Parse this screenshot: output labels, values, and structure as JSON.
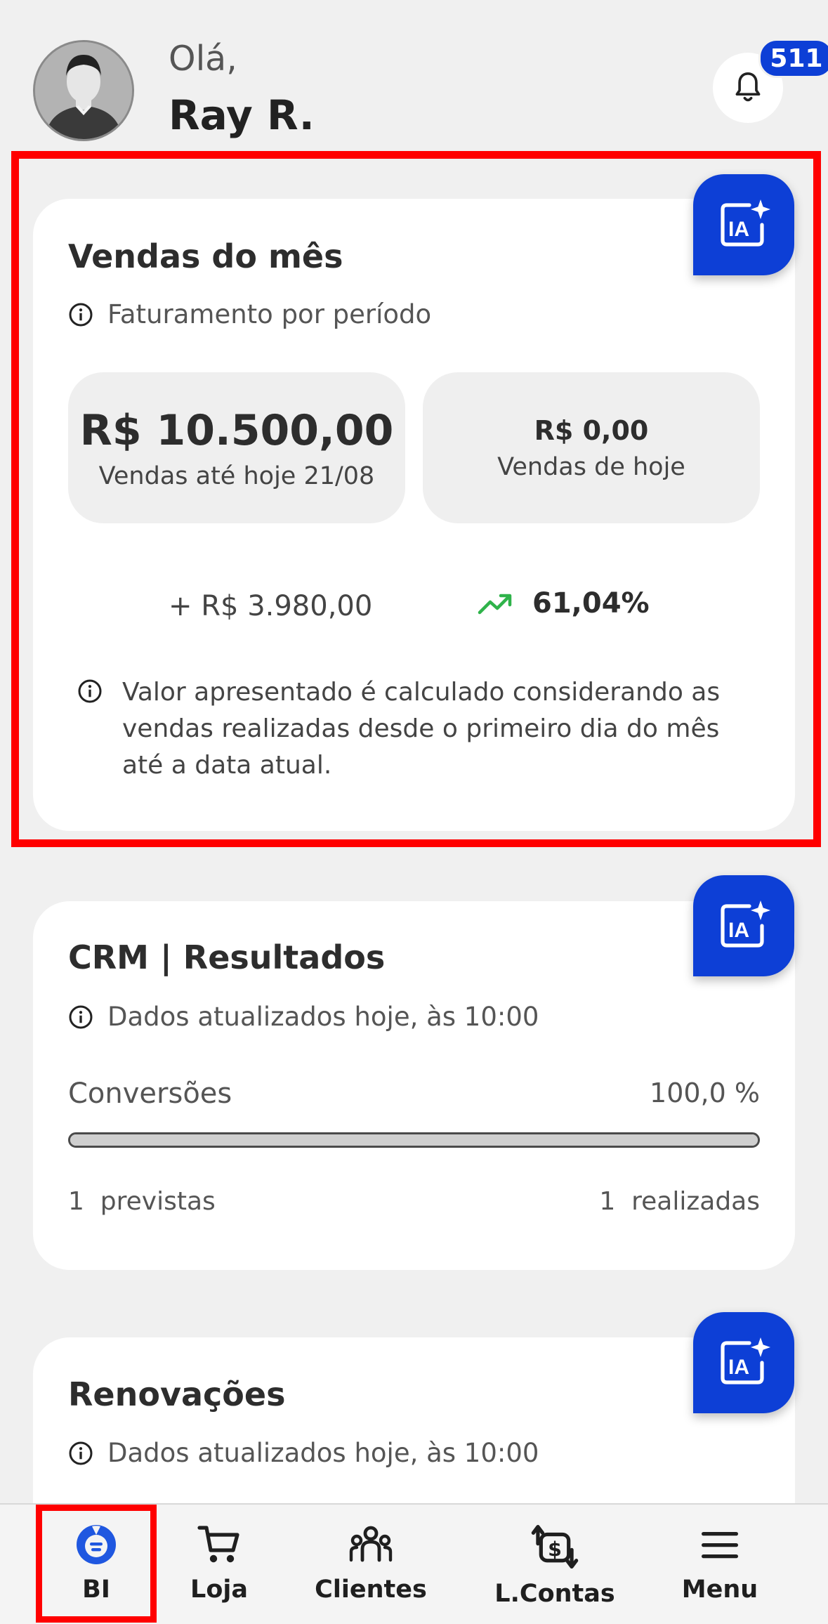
{
  "header": {
    "greeting": "Olá,",
    "user_name": "Ray R.",
    "notification_count": "511"
  },
  "sales_card": {
    "title": "Vendas do mês",
    "info": "Faturamento por período",
    "month_total": "R$ 10.500,00",
    "month_total_label": "Vendas até hoje 21/08",
    "today_total": "R$ 0,00",
    "today_label": "Vendas de hoje",
    "difference": "+ R$ 3.980,00",
    "growth_percent": "61,04%",
    "note": "Valor apresentado é calculado considerando as vendas realizadas desde o primeiro dia do mês até a data atual."
  },
  "crm_card": {
    "title": "CRM | Resultados",
    "info": "Dados atualizados hoje, às 10:00",
    "conversions_label": "Conversões",
    "conversions_value": "100,0 %",
    "conversions_progress": 1.0,
    "forecast": "1  previstas",
    "achieved": "1  realizadas"
  },
  "renewals_card": {
    "title": "Renovações",
    "info": "Dados atualizados hoje, às 10:00"
  },
  "ia_button_label": "IA",
  "bottom_nav": {
    "items": [
      {
        "label": "BI",
        "icon": "bi-icon"
      },
      {
        "label": "Loja",
        "icon": "cart-icon"
      },
      {
        "label": "Clientes",
        "icon": "people-icon"
      },
      {
        "label": "L.Contas",
        "icon": "money-transfer-icon"
      },
      {
        "label": "Menu",
        "icon": "hamburger-icon"
      }
    ]
  },
  "colors": {
    "accent": "#0d3fd6",
    "highlight": "#ff0000",
    "trend_up": "#2fb34a",
    "background": "#f0f0f0"
  }
}
